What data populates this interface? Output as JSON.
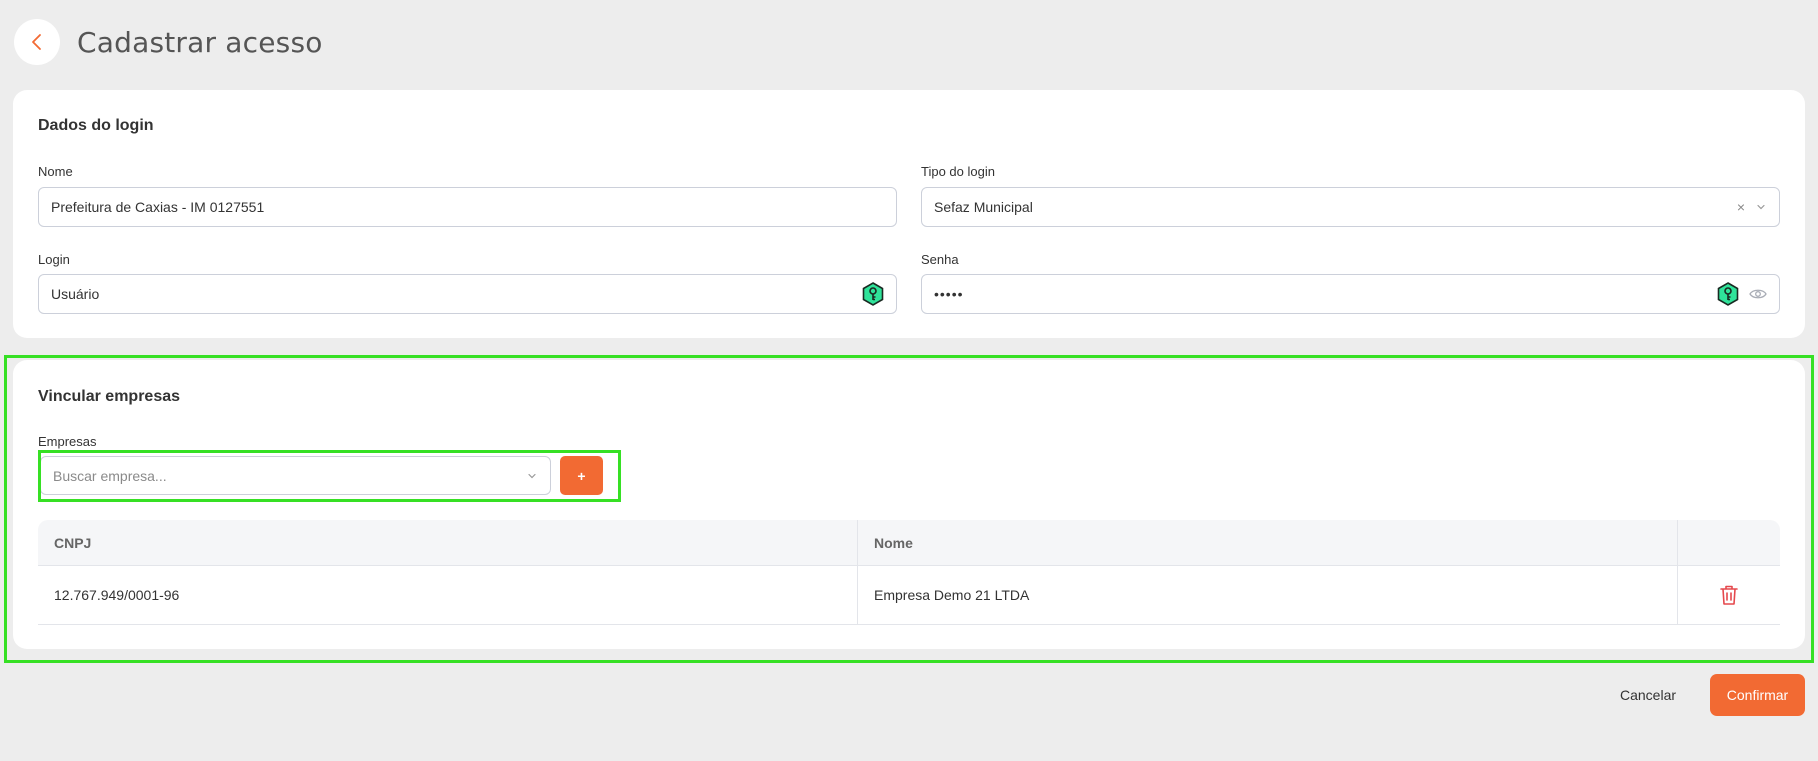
{
  "header": {
    "title": "Cadastrar acesso",
    "back_icon": "chevron-left-icon"
  },
  "login_section": {
    "title": "Dados do login",
    "nome": {
      "label": "Nome",
      "value": "Prefeitura de Caxias - IM 0127551"
    },
    "tipo": {
      "label": "Tipo do login",
      "value": "Sefaz Municipal",
      "clear": "×"
    },
    "login": {
      "label": "Login",
      "value": "Usuário"
    },
    "senha": {
      "label": "Senha",
      "value": "•••••"
    }
  },
  "empresas_section": {
    "title": "Vincular empresas",
    "label": "Empresas",
    "placeholder": "Buscar empresa...",
    "add_label": "+",
    "table": {
      "headers": [
        "CNPJ",
        "Nome",
        ""
      ],
      "rows": [
        {
          "cnpj": "12.767.949/0001-96",
          "nome": "Empresa Demo 21 LTDA"
        }
      ]
    }
  },
  "footer": {
    "cancel_label": "Cancelar",
    "confirm_label": "Confirmar"
  },
  "colors": {
    "accent": "#f26a33",
    "highlight": "#36e024",
    "key_badge": "#2fe39a",
    "delete": "#e5484d"
  }
}
